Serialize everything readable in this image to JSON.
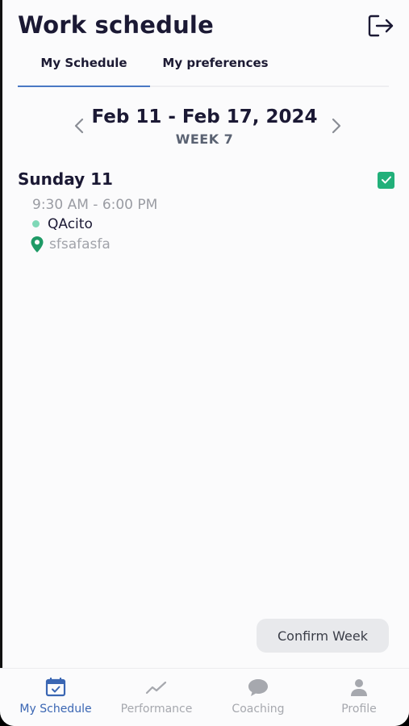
{
  "header": {
    "title": "Work schedule",
    "logout_icon": "logout-icon"
  },
  "tabs": [
    {
      "label": "My Schedule",
      "active": true
    },
    {
      "label": "My preferences",
      "active": false
    }
  ],
  "week": {
    "range": "Feb 11 - Feb 17, 2024",
    "label": "WEEK 7"
  },
  "days": [
    {
      "title": "Sunday 11",
      "confirmed": true,
      "time": "9:30 AM - 6:00 PM",
      "role": "QAcito",
      "location": "sfsafasfa"
    }
  ],
  "confirm_button": {
    "label": "Confirm Week"
  },
  "bottom_nav": [
    {
      "label": "My Schedule",
      "icon": "calendar-icon",
      "active": true
    },
    {
      "label": "Performance",
      "icon": "trend-icon",
      "active": false
    },
    {
      "label": "Coaching",
      "icon": "chat-bubble-icon",
      "active": false
    },
    {
      "label": "Profile",
      "icon": "person-icon",
      "active": false
    }
  ],
  "colors": {
    "accent": "#3a66b3",
    "success": "#22b07a",
    "role_dot": "#7fd8b7"
  }
}
